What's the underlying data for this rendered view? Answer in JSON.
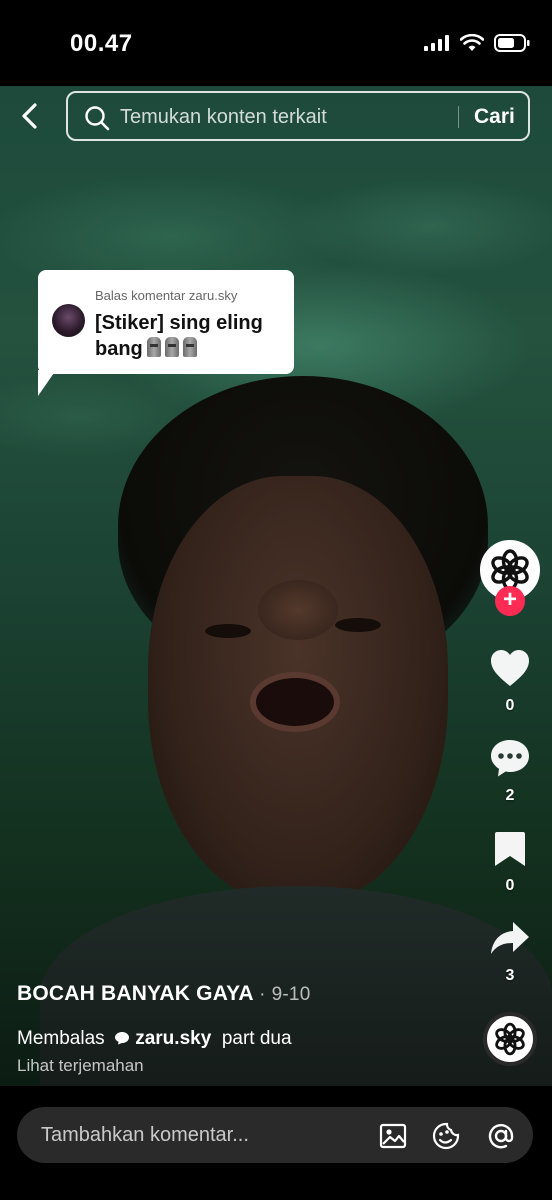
{
  "status_bar": {
    "time": "00.47"
  },
  "search": {
    "placeholder": "Temukan konten terkait",
    "button_label": "Cari"
  },
  "reply_card": {
    "header": "Balas komentar zaru.sky",
    "text": "[Stiker] sing eling bang"
  },
  "actions": {
    "likes": "0",
    "comments": "2",
    "bookmarks": "0",
    "shares": "3"
  },
  "caption": {
    "author": "BOCAH BANYAK GAYA",
    "separator": "·",
    "date": "9-10",
    "reply_prefix": "Membalas",
    "reply_user": "zaru.sky",
    "text": "part dua",
    "translate_label": "Lihat terjemahan"
  },
  "comment_bar": {
    "placeholder": "Tambahkan komentar..."
  },
  "colors": {
    "accent": "#fe2c55",
    "video_tint": "#1d4a3b"
  }
}
